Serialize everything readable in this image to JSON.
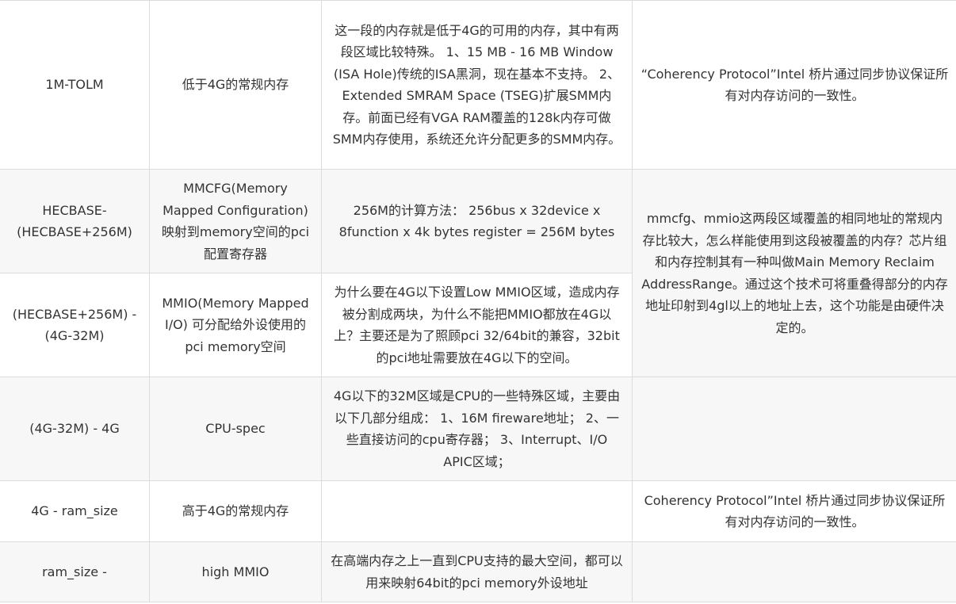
{
  "rows": [
    {
      "range": "1M-TOLM",
      "type": "低于4G的常规内存",
      "description": "这一段的内存就是低于4G的可用的内存，其中有两段区域比较特殊。 1、15 MB - 16 MB Window (ISA Hole)传统的ISA黑洞，现在基本不支持。 2、Extended SMRAM Space (TSEG)扩展SMM内存。前面已经有VGA RAM覆盖的128k内存可做SMM内存使用，系统还允许分配更多的SMM内存。",
      "note": "“Coherency Protocol”Intel 桥片通过同步协议保证所有对内存访问的一致性。"
    },
    {
      "range": "HECBASE-(HECBASE+256M)",
      "type": "MMCFG(Memory Mapped Configuration)映射到memory空间的pci配置寄存器",
      "description": "256M的计算方法： 256bus x 32device x 8function x 4k bytes register = 256M bytes",
      "note": "mmcfg、mmio这两段区域覆盖的相同地址的常规内存比较大，怎么样能使用到这段被覆盖的内存？芯片组和内存控制其有一种叫做Main Memory Reclaim AddressRange。通过这个技术可将重叠得部分的内存地址印射到4gl以上的地址上去，这个功能是由硬件决定的。"
    },
    {
      "range": "(HECBASE+256M) - (4G-32M)",
      "type": "MMIO(Memory Mapped I/O) 可分配给外设使用的pci memory空间",
      "description": "为什么要在4G以下设置Low MMIO区域，造成内存被分割成两块，为什么不能把MMIO都放在4G以上？主要还是为了照顾pci 32/64bit的兼容，32bit的pci地址需要放在4G以下的空间。"
    },
    {
      "range": "(4G-32M) - 4G",
      "type": "CPU-spec",
      "description": "4G以下的32M区域是CPU的一些特殊区域，主要由以下几部分组成： 1、16M fireware地址； 2、一些直接访问的cpu寄存器； 3、Interrupt、I/O APIC区域；",
      "note": ""
    },
    {
      "range": "4G - ram_size",
      "type": "高于4G的常规内存",
      "description": "",
      "note": "Coherency Protocol”Intel 桥片通过同步协议保证所有对内存访问的一致性。"
    },
    {
      "range": "ram_size -",
      "type": "high MMIO",
      "description": "在高端内存之上一直到CPU支持的最大空间，都可以用来映射64bit的pci memory外设地址",
      "note": ""
    }
  ]
}
